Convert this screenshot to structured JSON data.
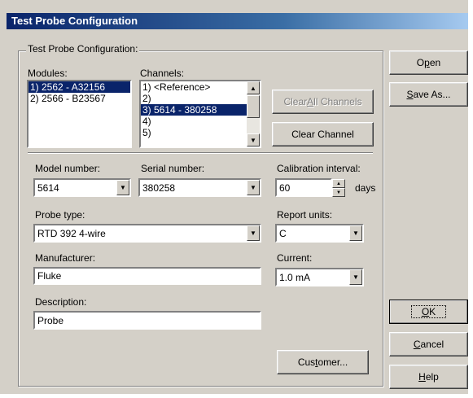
{
  "window": {
    "title": "Test Probe Configuration"
  },
  "group": {
    "label": "Test Probe Configuration:"
  },
  "modules": {
    "label": "Modules:",
    "items": [
      "1) 2562 - A32156",
      "2) 2566 - B23567"
    ],
    "selected_index": 0
  },
  "channels": {
    "label": "Channels:",
    "items": [
      "1) <Reference>",
      "2)",
      "3) 5614 - 380258",
      "4)",
      "5)"
    ],
    "selected_index": 2
  },
  "buttons": {
    "clear_all": {
      "pre": "Clear ",
      "u": "A",
      "post": "ll Channels"
    },
    "clear_channel": "Clear Channel",
    "open": {
      "pre": "O",
      "u": "p",
      "post": "en"
    },
    "save_as": {
      "pre": "",
      "u": "S",
      "post": "ave As..."
    },
    "ok": {
      "pre": "",
      "u": "O",
      "post": "K"
    },
    "cancel": {
      "pre": "",
      "u": "C",
      "post": "ancel"
    },
    "help": {
      "pre": "",
      "u": "H",
      "post": "elp"
    },
    "customer": {
      "pre": "Cus",
      "u": "t",
      "post": "omer..."
    }
  },
  "fields": {
    "model_number": {
      "label": "Model number:",
      "value": "5614"
    },
    "serial_number": {
      "label": "Serial number:",
      "value": "380258"
    },
    "calibration_interval": {
      "label": "Calibration interval:",
      "value": "60",
      "unit": "days"
    },
    "probe_type": {
      "label": "Probe type:",
      "value": "RTD 392 4-wire"
    },
    "report_units": {
      "label": "Report units:",
      "value": "C"
    },
    "manufacturer": {
      "label": "Manufacturer:",
      "value": "Fluke"
    },
    "current": {
      "label": "Current:",
      "value": "1.0 mA"
    },
    "description": {
      "label": "Description:",
      "value": "Probe"
    }
  },
  "colors": {
    "title_start": "#0a246a",
    "title_end": "#a6caf0",
    "dialog_bg": "#d4d0c8",
    "selection": "#0a246a"
  }
}
